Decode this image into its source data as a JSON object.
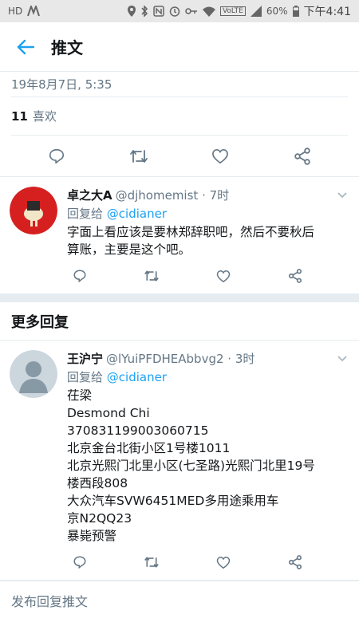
{
  "statusbar": {
    "left": "HD",
    "lte": "VoLTE",
    "battery": "60%",
    "time": "下午4:41"
  },
  "header": {
    "title": "推文"
  },
  "tweet": {
    "timestamp": "19年8月7日, 5:35",
    "likes_count": "11",
    "likes_label": "喜欢"
  },
  "replies": [
    {
      "name": "卓之大A",
      "handle": "@djhomemist · 7时",
      "reply_prefix": "回复给",
      "reply_to": "@cidianer",
      "lines": [
        "字面上看应该是要林郑辞职吧，然后不要秋后",
        "算账，主要是这个吧。"
      ]
    }
  ],
  "more_replies_title": "更多回复",
  "more_replies": [
    {
      "name": "王沪宁",
      "handle": "@lYuiPFDHEAbbvg2 · 3时",
      "reply_prefix": "回复给",
      "reply_to": "@cidianer",
      "lines": [
        "茌梁",
        "Desmond Chi",
        "370831199003060715",
        "北京金台北街小区1号楼1011",
        "北京光熙门北里小区(七圣路)光熙门北里19号",
        "楼西段808",
        "大众汽车SVW6451MED多用途乘用车",
        "京N2QQ23",
        "暴毙预警"
      ]
    }
  ],
  "composer": {
    "placeholder": "发布回复推文"
  },
  "colors": {
    "accent": "#1da1f2",
    "muted": "#657786",
    "divider": "#e6ecf0"
  }
}
